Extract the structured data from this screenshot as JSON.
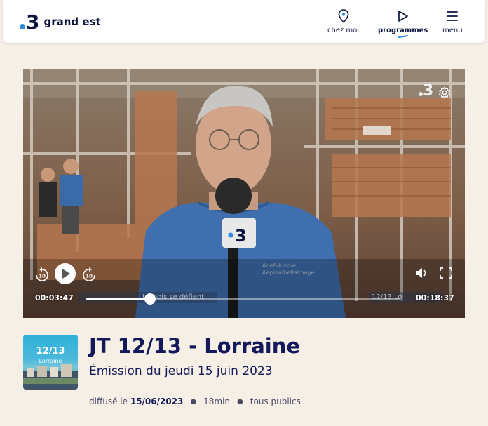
{
  "brand": {
    "number": "3",
    "region": "grand est"
  },
  "nav": {
    "items": [
      {
        "label": "chez moi",
        "icon": "location-pin-icon"
      },
      {
        "label": "programmes",
        "icon": "play-icon",
        "active": true
      },
      {
        "label": "menu",
        "icon": "menu-icon"
      }
    ]
  },
  "player": {
    "elapsed": "00:03:47",
    "duration": "00:18:37",
    "progress": 0.204,
    "overlay_left": "Le bois se défient",
    "overlay_right": "12/13 Lo",
    "accent": "#2c8be0"
  },
  "program": {
    "thumb_title": "12/13",
    "thumb_sub": "Lorraine",
    "title": "JT 12/13 - Lorraine",
    "subtitle": "Émission du jeudi 15 juin 2023",
    "meta_prefix": "diffusé le",
    "date": "15/06/2023",
    "duration": "18min",
    "audience": "tous publics"
  }
}
